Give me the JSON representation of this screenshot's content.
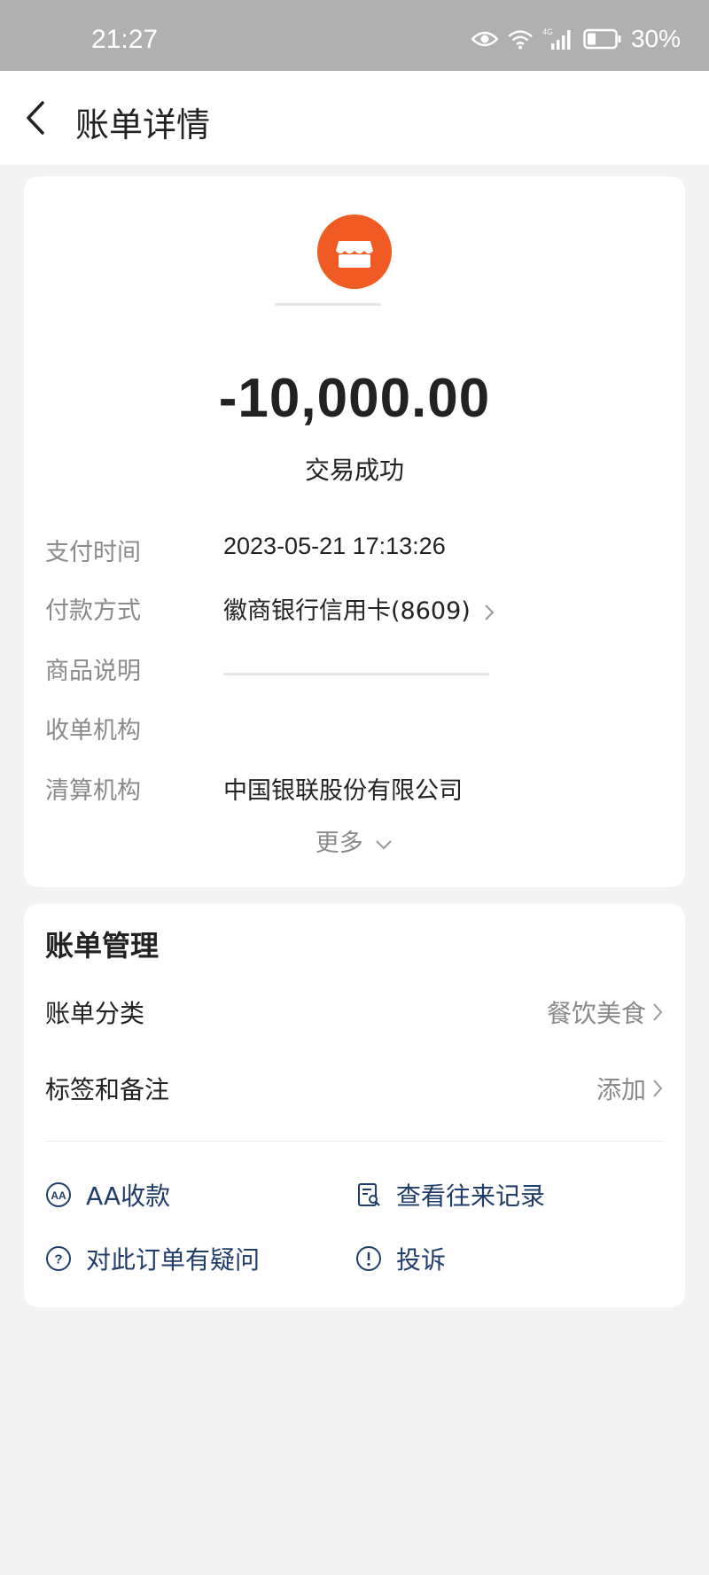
{
  "status_bar": {
    "time": "21:27",
    "battery": "30%",
    "network": "4G",
    "icons": [
      "eye-icon",
      "wifi-icon",
      "signal-icon",
      "battery-icon"
    ]
  },
  "header": {
    "title": "账单详情",
    "back_icon": "back-chevron-icon"
  },
  "transaction": {
    "merchant_icon": "store-icon",
    "merchant_icon_color": "#ef5b23",
    "amount": "-10,000.00",
    "status": "交易成功",
    "details": [
      {
        "label": "支付时间",
        "value": "2023-05-21 17:13:26",
        "link": false
      },
      {
        "label": "付款方式",
        "value": "徽商银行信用卡(8609)",
        "link": true
      },
      {
        "label": "商品说明",
        "value": "",
        "link": false
      },
      {
        "label": "收单机构",
        "value": "",
        "link": false
      },
      {
        "label": "清算机构",
        "value": "中国银联股份有限公司",
        "link": false
      }
    ],
    "more_label": "更多"
  },
  "bill_management": {
    "title": "账单管理",
    "rows": [
      {
        "label": "账单分类",
        "value": "餐饮美食"
      },
      {
        "label": "标签和备注",
        "value": "添加"
      }
    ],
    "actions": [
      {
        "label": "AA收款",
        "icon": "aa-icon"
      },
      {
        "label": "查看往来记录",
        "icon": "records-icon"
      },
      {
        "label": "对此订单有疑问",
        "icon": "question-icon"
      },
      {
        "label": "投诉",
        "icon": "exclamation-icon"
      }
    ],
    "accent_color": "#1f3d6b"
  }
}
